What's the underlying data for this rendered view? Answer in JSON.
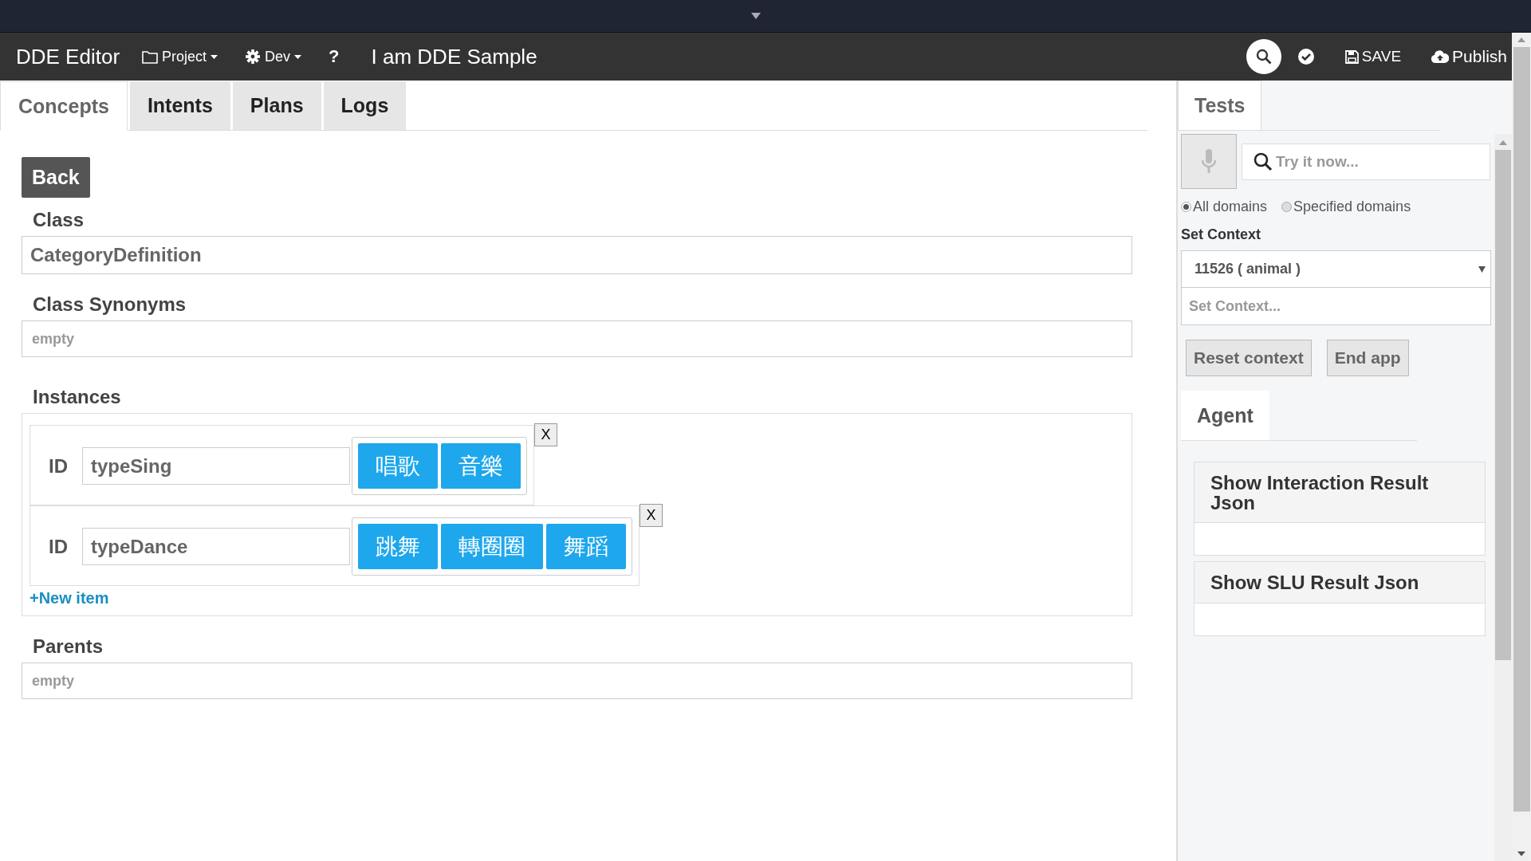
{
  "navbar": {
    "brand": "DDE Editor",
    "menus": [
      {
        "label": "Project",
        "kind": "folder"
      },
      {
        "label": "Dev",
        "kind": "gear"
      }
    ],
    "help": "?",
    "title": "I am DDE Sample",
    "actions": [
      {
        "label": "SAVE",
        "kind": "save"
      },
      {
        "label": "Publish",
        "kind": "cloud"
      }
    ]
  },
  "tabs": [
    {
      "label": "Concepts",
      "selected": true
    },
    {
      "label": "Intents",
      "selected": false
    },
    {
      "label": "Plans",
      "selected": false
    },
    {
      "label": "Logs",
      "selected": false
    }
  ],
  "back_button": "Back",
  "class": {
    "label": "Class",
    "value": "CategoryDefinition"
  },
  "class_synonyms": {
    "label": "Class Synonyms",
    "placeholder": "empty"
  },
  "instances": {
    "label": "Instances",
    "items": [
      {
        "id_label": "ID",
        "value": "typeSing",
        "synonyms": [
          "唱歌",
          "音樂"
        ],
        "remove": "X"
      },
      {
        "id_label": "ID",
        "value": "typeDance",
        "synonyms": [
          "跳舞",
          "轉圈圈",
          "舞蹈"
        ],
        "remove": "X"
      }
    ],
    "new_item": "+New item"
  },
  "parents": {
    "label": "Parents",
    "placeholder": "empty"
  },
  "tests": {
    "tabs": [
      {
        "label": "Tests",
        "selected": true
      }
    ],
    "search_placeholder": "Try it now...",
    "domains": [
      {
        "label": "All domains",
        "selected": true
      },
      {
        "label": "Specified domains",
        "selected": false
      }
    ],
    "context_label": "Set Context",
    "context_value": "11526 ( animal )",
    "context_placeholder": "Set Context...",
    "buttons": [
      "Reset context",
      "End app"
    ],
    "agent_tabs": [
      {
        "label": "Agent",
        "selected": true
      }
    ],
    "panels": [
      "Show Interaction Result Json",
      "Show SLU Result Json"
    ]
  }
}
